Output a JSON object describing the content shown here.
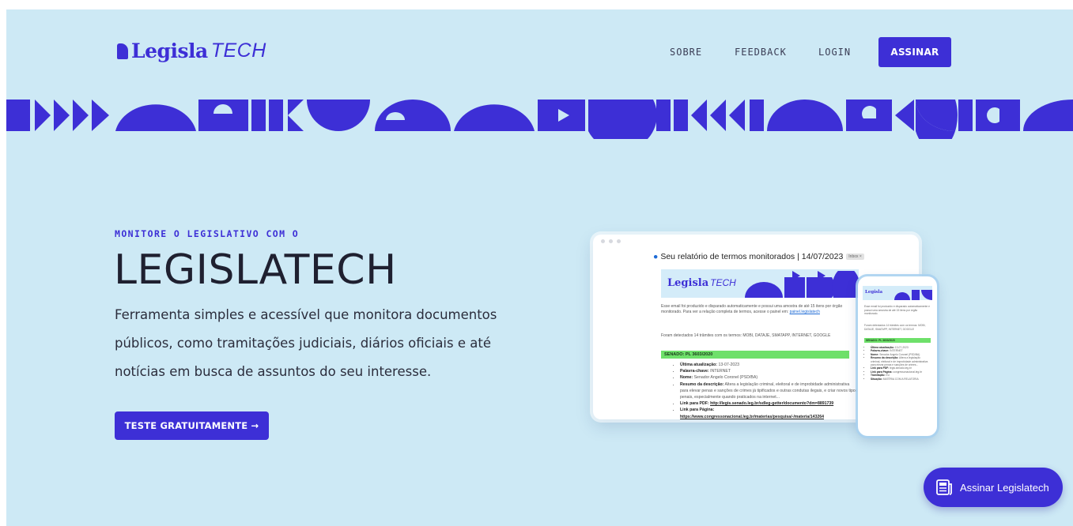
{
  "header": {
    "logo_bold": "Legisla",
    "logo_light": "TECH",
    "nav": [
      {
        "label": "SOBRE"
      },
      {
        "label": "FEEDBACK"
      },
      {
        "label": "LOGIN"
      }
    ],
    "cta_label": "ASSINAR"
  },
  "hero": {
    "kicker": "MONITORE O LEGISLATIVO COM O",
    "title": "LEGISLATECH",
    "description": "Ferramenta simples e acessível que monitora documentos públicos, como tramitações judiciais, diários oficiais e até notícias em busca de assuntos do seu interesse.",
    "cta_label": "TESTE GRATUITAMENTE →"
  },
  "mock_email": {
    "subject": "Seu relatório de termos monitorados | 14/07/2023",
    "tag": "Inbox ×",
    "banner_logo_bold": "Legisla",
    "banner_logo_light": "TECH",
    "intro": "Esse email foi produzido e disparado automaticamente e possui uma amostra de até 15 itens por órgão monitorado. Para ver a relação completa de termos, acesse o painel em:",
    "intro_link": "painel.legislatech",
    "summary": "Foram detectados 14 trâmites com os termos: MOBI, DATAJE, SMATAPP, INTERNET, GOOGLE",
    "section": "SENADO: PL 3603/2020",
    "items": [
      {
        "label": "Última atualização:",
        "value": "13-07-2023"
      },
      {
        "label": "Palavra-chave:",
        "value": "INTERNET"
      },
      {
        "label": "Nome:",
        "value": "Senador Angelo Coronel (PSD/BA)"
      },
      {
        "label": "Resumo da descrição:",
        "value": "Altera a legislação criminal, eleitoral e de improbidade administrativa para elevar penas e sanções de crimes já tipificados e outras condutas ilegais, e criar novos tipos penais, especialmente quando praticados na internet..."
      },
      {
        "label": "Link para PDF:",
        "value": "http://legis.senado.leg.br/sdleg-getter/documento?dm=8891739"
      },
      {
        "label": "Link para Página:",
        "value": "https://www.congressonacional.leg.br/materias/pesquisa/-/materia/143264"
      }
    ]
  },
  "mock_phone": {
    "logo": "Legisla",
    "intro": "Esse email foi produzido e disparado automaticamente e possui uma amostra de até 15 itens por órgão monitorado.",
    "summary": "Foram detectados 14 trâmites com os termos: MOBI, DATAJE, SMATAPP, INTERNET, GOOGLE",
    "section": "SENADO: PL 3603/2020",
    "items": [
      {
        "label": "Última atualização:",
        "value": "13-07-2023"
      },
      {
        "label": "Palavra-chave:",
        "value": "INTERNET"
      },
      {
        "label": "Nome:",
        "value": "Senador Angelo Coronel (PSD/BA)"
      },
      {
        "label": "Resumo da descrição:",
        "value": "Altera a legislação criminal, eleitoral e de improbidade administrativa para elevar penas e sanções de crimes..."
      },
      {
        "label": "Link para PDF:",
        "value": "legis.senado.leg.br"
      },
      {
        "label": "Link para Página:",
        "value": "congressonacional.leg.br"
      },
      {
        "label": "Tramitação:",
        "value": "EU"
      },
      {
        "label": "Situação:",
        "value": "MATÉRIA COM A RELATORIA"
      }
    ]
  },
  "floating_button": {
    "label": "Assinar Legislatech",
    "icon": "newspaper-icon"
  },
  "colors": {
    "brand": "#3d2fd6",
    "background": "#cde9f5",
    "text": "#1f2030",
    "highlight_green": "#6ee06a"
  }
}
